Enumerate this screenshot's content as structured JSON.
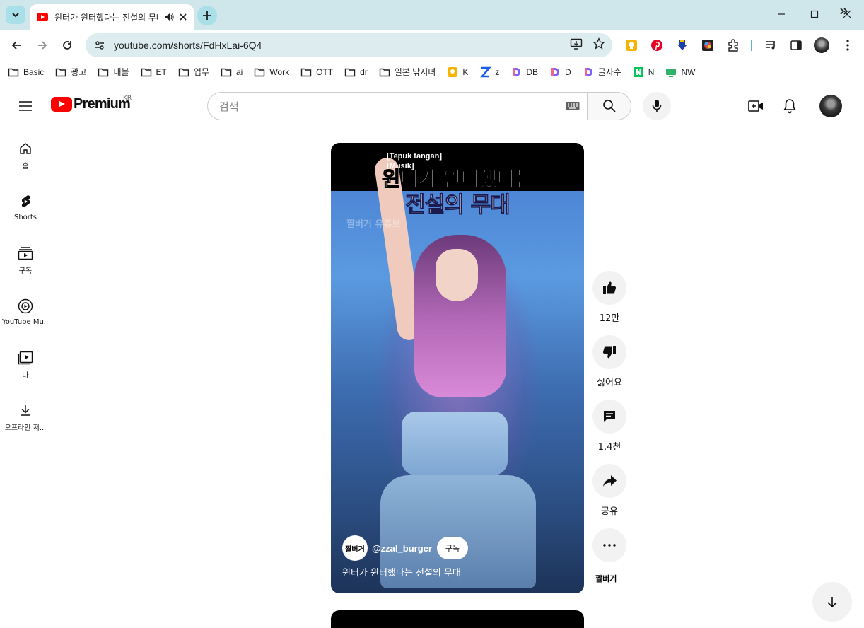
{
  "browser": {
    "tab_title": "윈터가 윈터했다는 전설의 무대",
    "url": "youtube.com/shorts/FdHxLai-6Q4",
    "bookmarks": [
      {
        "label": "Basic",
        "icon": "folder-icon"
      },
      {
        "label": "광고",
        "icon": "folder-icon"
      },
      {
        "label": "내블",
        "icon": "folder-icon"
      },
      {
        "label": "ET",
        "icon": "folder-icon"
      },
      {
        "label": "업무",
        "icon": "folder-icon"
      },
      {
        "label": "ai",
        "icon": "folder-icon"
      },
      {
        "label": "Work",
        "icon": "folder-icon"
      },
      {
        "label": "OTT",
        "icon": "folder-icon"
      },
      {
        "label": "dr",
        "icon": "folder-icon"
      },
      {
        "label": "일본 낚시녀",
        "icon": "folder-icon"
      },
      {
        "label": "K",
        "icon": "k-site-icon"
      },
      {
        "label": "z",
        "icon": "z-site-icon"
      },
      {
        "label": "DB",
        "icon": "d-site-icon"
      },
      {
        "label": "D",
        "icon": "d-site-icon"
      },
      {
        "label": "글자수",
        "icon": "d-site-icon"
      },
      {
        "label": "N",
        "icon": "naver-icon"
      },
      {
        "label": "NW",
        "icon": "nw-site-icon"
      }
    ]
  },
  "youtube": {
    "logo_text": "Premium",
    "region": "KR",
    "search_placeholder": "검색",
    "guide": [
      {
        "label": "홈",
        "icon": "home-icon"
      },
      {
        "label": "Shorts",
        "icon": "shorts-icon"
      },
      {
        "label": "구독",
        "icon": "subscriptions-icon"
      },
      {
        "label": "YouTube Mu...",
        "icon": "youtube-music-icon"
      },
      {
        "label": "나",
        "icon": "you-icon"
      },
      {
        "label": "오프라인 저...",
        "icon": "download-icon"
      }
    ],
    "short": {
      "caption_small_1": "[Tepuk tangan]",
      "caption_small_2": "[Musik]",
      "overlay_line1": "윈터가 윈터했다는",
      "overlay_line2": "전설의 무대",
      "watermark": "짤버거 유튜브",
      "channel_avatar_text": "짤버거",
      "channel_handle": "@zzal_burger",
      "subscribe_label": "구독",
      "title": "윈터가 윈터했다는 전설의 무대"
    },
    "actions": {
      "like_count": "12만",
      "dislike_label": "싫어요",
      "comment_count": "1.4천",
      "share_label": "공유"
    },
    "sound_label": "짤버거"
  }
}
